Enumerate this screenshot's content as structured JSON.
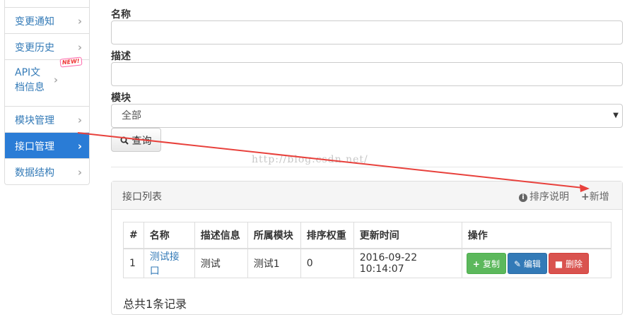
{
  "sidebar": {
    "items": [
      {
        "label": ""
      },
      {
        "label": "变更通知"
      },
      {
        "label": "变更历史"
      },
      {
        "label_line1": "API文",
        "label_line2": "档信息",
        "badge": "NEW!"
      },
      {
        "label": "模块管理"
      },
      {
        "label": "接口管理"
      },
      {
        "label": "数据结构"
      }
    ]
  },
  "form": {
    "name_label": "名称",
    "name_value": "",
    "desc_label": "描述",
    "desc_value": "",
    "module_label": "模块",
    "module_selected": "全部",
    "query_label": "查询"
  },
  "panel": {
    "title": "接口列表",
    "sort_help_label": "排序说明",
    "add_label": "新增",
    "columns": [
      "#",
      "名称",
      "描述信息",
      "所属模块",
      "排序权重",
      "更新时间",
      "操作"
    ],
    "rows": [
      {
        "index": "1",
        "name": "测试接口",
        "desc": "测试",
        "module": "测试1",
        "weight": "0",
        "updated": "2016-09-22 10:14:07"
      }
    ],
    "actions": {
      "copy": "复制",
      "edit": "编辑",
      "delete": "删除"
    },
    "total_text": "总共1条记录"
  },
  "watermark": "http://blog.csdn.net/",
  "colors": {
    "accent": "#2a7cd6",
    "arrow": "#e8413c",
    "link": "#337ab7"
  }
}
